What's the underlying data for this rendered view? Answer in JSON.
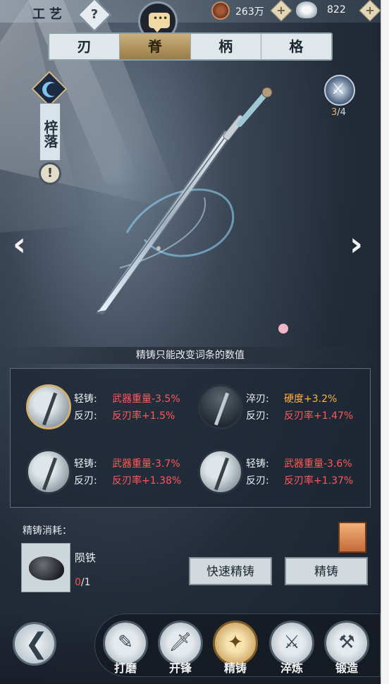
{
  "header": {
    "title": "工艺",
    "help": "?",
    "copper": "263万",
    "silver": "822",
    "plus": "+"
  },
  "tabs": [
    "刃",
    "脊",
    "柄",
    "格"
  ],
  "active_tab": 1,
  "weapon": {
    "name": "梓落",
    "warn": "!",
    "skill_current": "3",
    "skill_total": "/4"
  },
  "nav_arrows": {
    "left": "‹",
    "right": "›"
  },
  "info": "精铸只能改变词条的数值",
  "entries": [
    {
      "k1": "轻铸:",
      "v1": "武器重量-3.5%",
      "k2": "反刃:",
      "v2": "反刃率+1.5%"
    },
    {
      "k1": "淬刃:",
      "v1": "硬度+3.2%",
      "k2": "反刃:",
      "v2": "反刃率+1.47%"
    },
    {
      "k1": "轻铸:",
      "v1": "武器重量-3.7%",
      "k2": "反刃:",
      "v2": "反刃率+1.38%"
    },
    {
      "k1": "轻铸:",
      "v1": "武器重量-3.6%",
      "k2": "反刃:",
      "v2": "反刃率+1.37%"
    }
  ],
  "cost": {
    "title": "精铸消耗：",
    "material_name": "陨铁",
    "have": "0",
    "need": "/1"
  },
  "buttons": {
    "quick": "快速精铸",
    "cast": "精铸"
  },
  "bottom_nav": [
    {
      "label": "打磨",
      "icon": "grind-icon"
    },
    {
      "label": "开锋",
      "icon": "sharpen-icon"
    },
    {
      "label": "精铸",
      "icon": "refine-icon"
    },
    {
      "label": "淬炼",
      "icon": "temper-icon"
    },
    {
      "label": "锻造",
      "icon": "forge-icon"
    }
  ],
  "active_nav": 2,
  "colors": {
    "negative_value": "#ff5a5a",
    "positive_value": "#ffb13c",
    "accent_gold": "#c9b07c"
  }
}
